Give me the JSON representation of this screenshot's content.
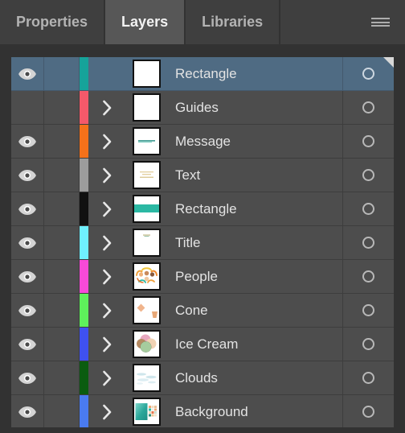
{
  "panel": {
    "tabs": [
      {
        "label": "Properties",
        "active": false
      },
      {
        "label": "Layers",
        "active": true
      },
      {
        "label": "Libraries",
        "active": false
      }
    ],
    "menu_icon": "hamburger-menu-icon",
    "colors": {
      "panel_bg": "#323232",
      "tab_bg": "#3f3f3f",
      "tab_active_bg": "#575757",
      "row_bg": "#4d4d4d",
      "row_selected_bg": "#4f6b83",
      "text": "#e3e3e3",
      "text_muted": "#b3b3b3"
    }
  },
  "layers": [
    {
      "name": "Rectangle",
      "visible": true,
      "selected": true,
      "expandable": false,
      "color": "#16a39a",
      "thumb": "blank",
      "target": "target-circle-icon",
      "corner_marker": true
    },
    {
      "name": "Guides",
      "visible": false,
      "selected": false,
      "expandable": true,
      "color": "#f4596a",
      "thumb": "blank",
      "target": "target-circle-icon",
      "corner_marker": false
    },
    {
      "name": "Message",
      "visible": true,
      "selected": false,
      "expandable": true,
      "color": "#f4711a",
      "thumb": "teal-text-line",
      "target": "target-circle-icon",
      "corner_marker": false
    },
    {
      "name": "Text",
      "visible": true,
      "selected": false,
      "expandable": true,
      "color": "#9c9c9c",
      "thumb": "tan-text-lines",
      "target": "target-circle-icon",
      "corner_marker": false
    },
    {
      "name": "Rectangle",
      "visible": true,
      "selected": false,
      "expandable": true,
      "color": "#111111",
      "thumb": "teal-band",
      "target": "target-circle-icon",
      "corner_marker": false
    },
    {
      "name": "Title",
      "visible": true,
      "selected": false,
      "expandable": true,
      "color": "#6ff0ff",
      "thumb": "small-title-text",
      "target": "target-circle-icon",
      "corner_marker": false
    },
    {
      "name": "People",
      "visible": true,
      "selected": false,
      "expandable": true,
      "color": "#f councils",
      "thumb": "people-illustration",
      "target": "target-circle-icon",
      "corner_marker": false
    },
    {
      "name": "Cone",
      "visible": true,
      "selected": false,
      "expandable": true,
      "color": "#5ef05b",
      "thumb": "cone-illustration",
      "target": "target-circle-icon",
      "corner_marker": false
    },
    {
      "name": "Ice Cream",
      "visible": true,
      "selected": false,
      "expandable": true,
      "color": "#3f51f0",
      "thumb": "ice-cream-scoops",
      "target": "target-circle-icon",
      "corner_marker": false
    },
    {
      "name": "Clouds",
      "visible": true,
      "selected": false,
      "expandable": true,
      "color": "#0b5c10",
      "thumb": "clouds-illustration",
      "target": "target-circle-icon",
      "corner_marker": false
    },
    {
      "name": "Background",
      "visible": true,
      "selected": false,
      "expandable": true,
      "color": "#4a7bf0",
      "thumb": "background-swatches",
      "target": "target-circle-icon",
      "corner_marker": false
    }
  ],
  "layer_colors_fixed": {
    "people": "#f74ad8"
  }
}
